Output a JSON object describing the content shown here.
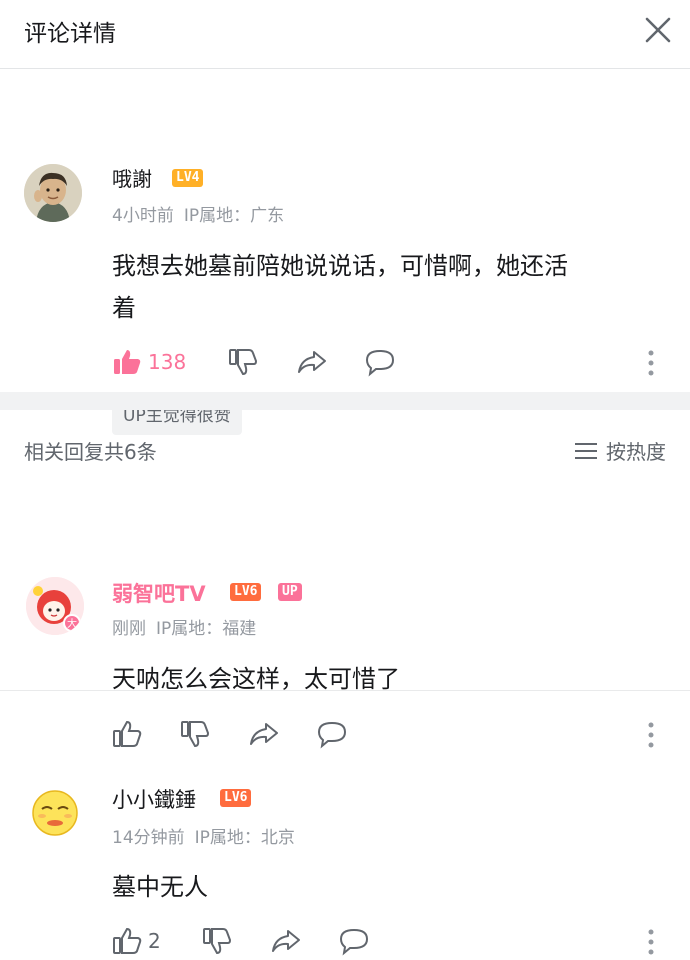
{
  "header": {
    "title": "评论详情"
  },
  "main_comment": {
    "username": "哦謝",
    "level": "LV4",
    "time": "4小时前",
    "ip_location": "IP属地：广东",
    "content_line1": "我想去她墓前陪她说说话，可惜啊，她还活",
    "content_line2": "着",
    "like_count": "138",
    "tag": "UP主觉得很赞"
  },
  "replies_header": {
    "count_label": "相关回复共6条",
    "sort_label": "按热度"
  },
  "replies": [
    {
      "username": "弱智吧TV",
      "level": "LV6",
      "up_badge": "UP",
      "time": "刚刚",
      "ip_location": "IP属地：福建",
      "content": "天呐怎么会这样，太可惜了",
      "like_count": ""
    },
    {
      "username": "小小鐵錘",
      "level": "LV6",
      "time": "14分钟前",
      "ip_location": "IP属地：北京",
      "content": "墓中无人",
      "like_count": "2"
    }
  ],
  "colors": {
    "like_active": "#fb7299",
    "lv4": "#ffb027",
    "lv6": "#ff6c3e",
    "up_badge": "#fb7299",
    "username_vip": "#fb7299"
  }
}
